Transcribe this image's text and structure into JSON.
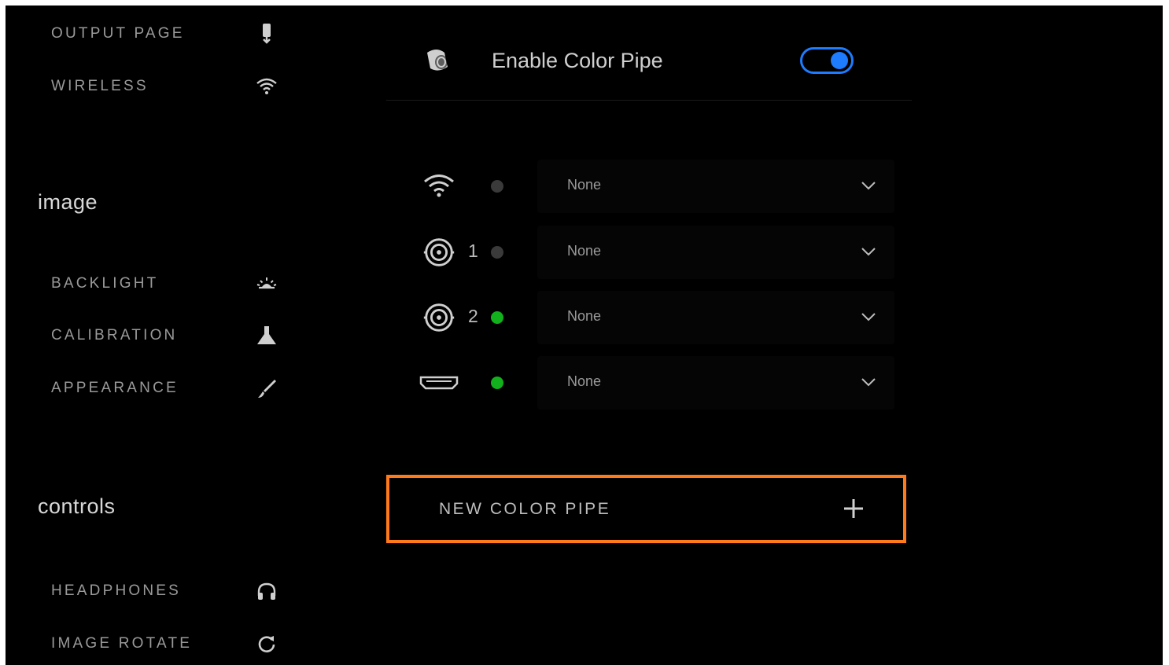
{
  "sidebar": {
    "top_items": [
      {
        "label": "OUTPUT PAGE",
        "icon": "output-page-icon"
      },
      {
        "label": "WIRELESS",
        "icon": "wifi-icon"
      }
    ],
    "sections": [
      {
        "title": "image",
        "items": [
          {
            "label": "BACKLIGHT",
            "icon": "backlight-icon"
          },
          {
            "label": "CALIBRATION",
            "icon": "calibration-icon"
          },
          {
            "label": "APPEARANCE",
            "icon": "brush-icon"
          }
        ]
      },
      {
        "title": "controls",
        "items": [
          {
            "label": "HEADPHONES",
            "icon": "headphones-icon"
          },
          {
            "label": "IMAGE ROTATE",
            "icon": "rotate-icon"
          }
        ]
      }
    ]
  },
  "main": {
    "enable": {
      "label": "Enable Color Pipe",
      "icon": "color-pipe-icon",
      "enabled": true,
      "accent": "#1d7cff"
    },
    "inputs": [
      {
        "icon": "wifi-icon",
        "number": "",
        "status_color": "#3a3a3a",
        "value": "None"
      },
      {
        "icon": "sdi-connector-icon",
        "number": "1",
        "status_color": "#3a3a3a",
        "value": "None"
      },
      {
        "icon": "sdi-connector-icon",
        "number": "2",
        "status_color": "#12b01c",
        "value": "None"
      },
      {
        "icon": "hdmi-icon",
        "number": "",
        "status_color": "#12b01c",
        "value": "None"
      }
    ],
    "new_pipe": {
      "label": "NEW COLOR PIPE",
      "icon": "plus-icon",
      "highlight_color": "#ff7a1a"
    }
  }
}
